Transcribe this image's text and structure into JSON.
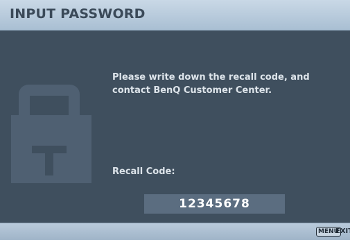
{
  "header": {
    "title": "INPUT PASSWORD"
  },
  "main": {
    "lock_icon": "lock-icon",
    "message": "Please write down the recall code, and contact BenQ Customer Center.",
    "recall_label": "Recall Code:",
    "recall_code": "12345678"
  },
  "footer": {
    "menu_key": "MENU",
    "exit_label": "EXIT"
  },
  "colors": {
    "background": "#3f4f5e",
    "header": "#b9cadb",
    "code_box": "#5b6d80",
    "text": "#dde4ea"
  }
}
